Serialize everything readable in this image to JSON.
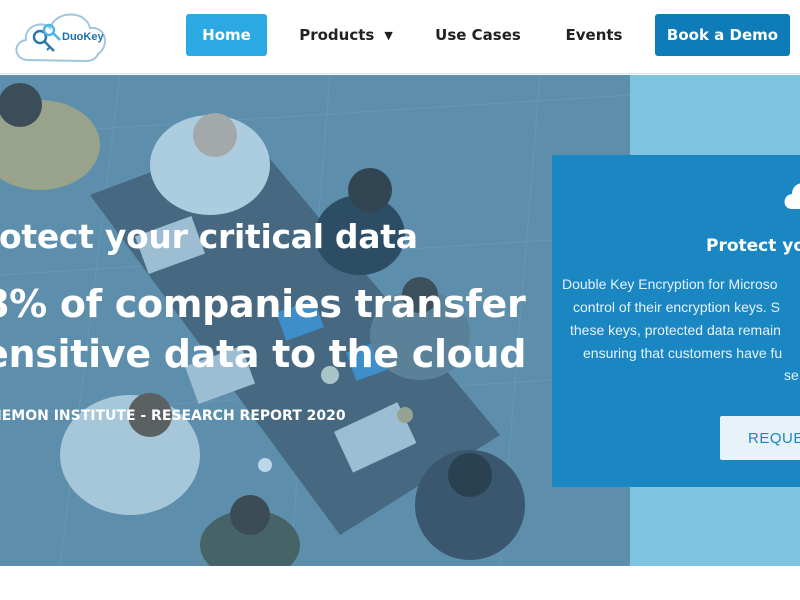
{
  "brand": {
    "logo_text": "DuoKey"
  },
  "nav": {
    "home": "Home",
    "products": "Products",
    "products_caret": "▼",
    "use_cases": "Use Cases",
    "events": "Events",
    "book_demo": "Book a Demo"
  },
  "hero": {
    "line1": "rotect your critical data",
    "line2": "8% of companies transfer",
    "line3": "ensitive data to the cloud",
    "source": "NEMON INSTITUTE - RESEARCH REPORT 2020"
  },
  "card": {
    "title": "Protect yo",
    "lines": [
      "Double Key Encryption for Microso",
      "control of their encryption keys. S",
      "these keys, protected data remain",
      "ensuring that customers have fu",
      "se"
    ],
    "button": "REQUES"
  },
  "colors": {
    "accent": "#2aa9e2",
    "demo_button": "#0e7cb8",
    "card_bg": "#1a86c2",
    "hero_side": "#7ec3e0"
  },
  "icons": {
    "logo": "cloud-key-logo-icon",
    "card": "cloud-icon",
    "dropdown": "caret-down-icon"
  }
}
